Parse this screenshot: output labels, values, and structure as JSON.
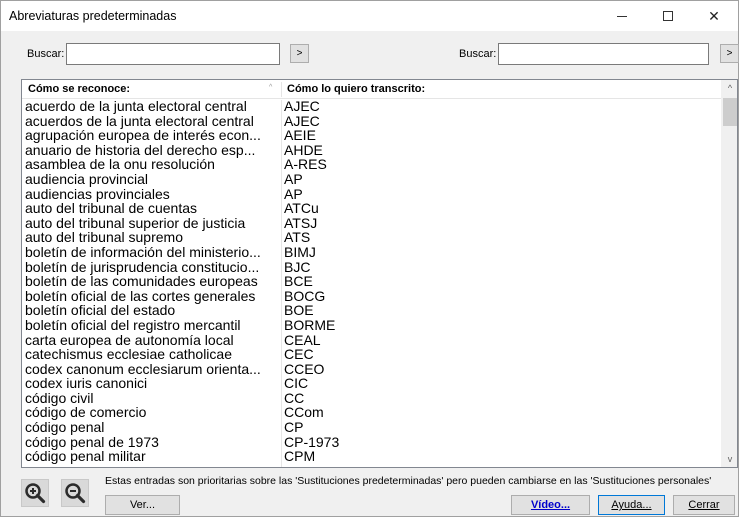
{
  "window": {
    "title": "Abreviaturas predeterminadas",
    "minimize_glyph": "—",
    "maximize_glyph": "☐",
    "close_glyph": "✕"
  },
  "search": {
    "left_label": "Buscar:",
    "left_value": "",
    "left_go": ">",
    "right_label": "Buscar:",
    "right_value": "",
    "right_go": ">"
  },
  "list": {
    "headers": [
      "Cómo se reconoce:",
      "Cómo lo quiero transcrito:"
    ],
    "sort_glyph": "^",
    "rows": [
      [
        "acuerdo de la junta electoral central",
        "AJEC"
      ],
      [
        "acuerdos de la junta electoral central",
        "AJEC"
      ],
      [
        "agrupación europea de interés econ...",
        "AEIE"
      ],
      [
        "anuario de historia del derecho esp...",
        "AHDE"
      ],
      [
        "asamblea de la onu resolución",
        "A-RES"
      ],
      [
        "audiencia provincial",
        "AP"
      ],
      [
        "audiencias provinciales",
        "AP"
      ],
      [
        "auto del tribunal de cuentas",
        "ATCu"
      ],
      [
        "auto del tribunal superior de justicia",
        "ATSJ"
      ],
      [
        "auto del tribunal supremo",
        "ATS"
      ],
      [
        "boletín de información del ministerio...",
        "BIMJ"
      ],
      [
        "boletín de jurisprudencia constitucio...",
        "BJC"
      ],
      [
        "boletín de las comunidades europeas",
        "BCE"
      ],
      [
        "boletín oficial de las cortes generales",
        "BOCG"
      ],
      [
        "boletín oficial del estado",
        "BOE"
      ],
      [
        "boletín oficial del registro mercantil",
        "BORME"
      ],
      [
        "carta europea de autonomía local",
        "CEAL"
      ],
      [
        "catechismus ecclesiae catholicae",
        "CEC"
      ],
      [
        "codex canonum ecclesiarum orienta...",
        "CCEO"
      ],
      [
        "codex iuris canonici",
        "CIC"
      ],
      [
        "código civil",
        "CC"
      ],
      [
        "código de comercio",
        "CCom"
      ],
      [
        "código penal",
        "CP"
      ],
      [
        "código penal de 1973",
        "CP-1973"
      ],
      [
        "código penal militar",
        "CPM"
      ]
    ]
  },
  "scrollbar": {
    "up": "^",
    "down": "v"
  },
  "footer": {
    "note": "Estas entradas son prioritarias sobre las 'Sustituciones predeterminadas' pero pueden cambiarse en las 'Sustituciones personales'",
    "ver_label": "Ver...",
    "video_label": "Vídeo...",
    "ayuda_label": "Ayuda...",
    "cerrar_label": "Cerrar"
  },
  "colors": {
    "zoom_icon": "#2b2b2b",
    "accent": "#0078d7"
  }
}
